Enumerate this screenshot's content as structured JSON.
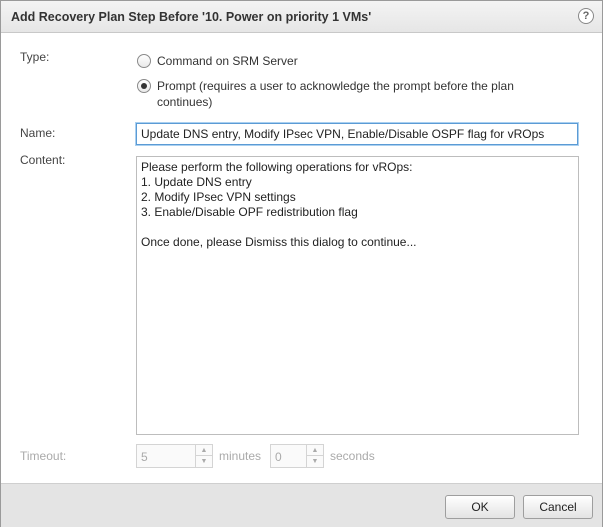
{
  "dialog": {
    "title": "Add Recovery Plan Step Before '10. Power on priority 1 VMs'",
    "help_label": "?"
  },
  "form": {
    "type_label": "Type:",
    "type_options": [
      {
        "label": "Command on SRM Server",
        "selected": false
      },
      {
        "label": "Prompt (requires a user to acknowledge the prompt before the plan continues)",
        "selected": true
      }
    ],
    "name_label": "Name:",
    "name_value": "Update DNS entry, Modify IPsec  VPN, Enable/Disable OSPF flag for vROps",
    "content_label": "Content:",
    "content_value": "Please perform the following operations for vROps:\n1. Update DNS entry\n2. Modify IPsec VPN settings\n3. Enable/Disable OPF redistribution flag\n\nOnce done, please Dismiss this dialog to continue...",
    "timeout_label": "Timeout:",
    "timeout_minutes": "5",
    "minutes_label": "minutes",
    "timeout_seconds": "0",
    "seconds_label": "seconds"
  },
  "footer": {
    "ok_label": "OK",
    "cancel_label": "Cancel"
  }
}
